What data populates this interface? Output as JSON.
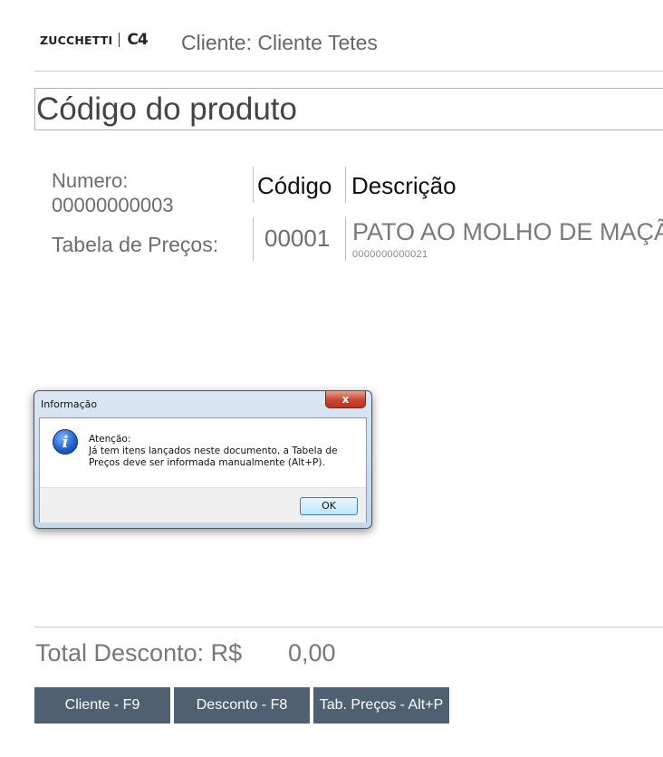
{
  "header": {
    "brand": "ZUCCHETTI",
    "brand_mark": "C4",
    "client_label": "Cliente: Cliente Tetes"
  },
  "product_input": {
    "placeholder": "Código do produto"
  },
  "info": {
    "numero_label": "Numero:",
    "numero_value": "00000000003",
    "tabela_label": "Tabela de Preços:"
  },
  "table": {
    "headers": [
      "Código",
      "Descrição"
    ],
    "rows": [
      {
        "codigo": "00001",
        "descricao": "PATO AO MOLHO DE MAÇÃ",
        "sub": "0000000000021"
      }
    ]
  },
  "dialog": {
    "title": "Informação",
    "close_label": "x",
    "icon": "info-icon",
    "message_heading": "Atenção:",
    "message_line1": "Já tem itens lançados neste documento, a Tabela de",
    "message_line2": "Preços deve ser informada manualmente (Alt+P).",
    "ok_label": "OK"
  },
  "footer": {
    "total_label": "Total Desconto: R$",
    "total_value": "0,00",
    "buttons": [
      "Cliente - F9",
      "Desconto - F8",
      "Tab. Preços - Alt+P"
    ]
  },
  "colors": {
    "button_bg": "#4f6170",
    "dialog_frame": "#c6d7ea",
    "close_button": "#c8452e"
  }
}
